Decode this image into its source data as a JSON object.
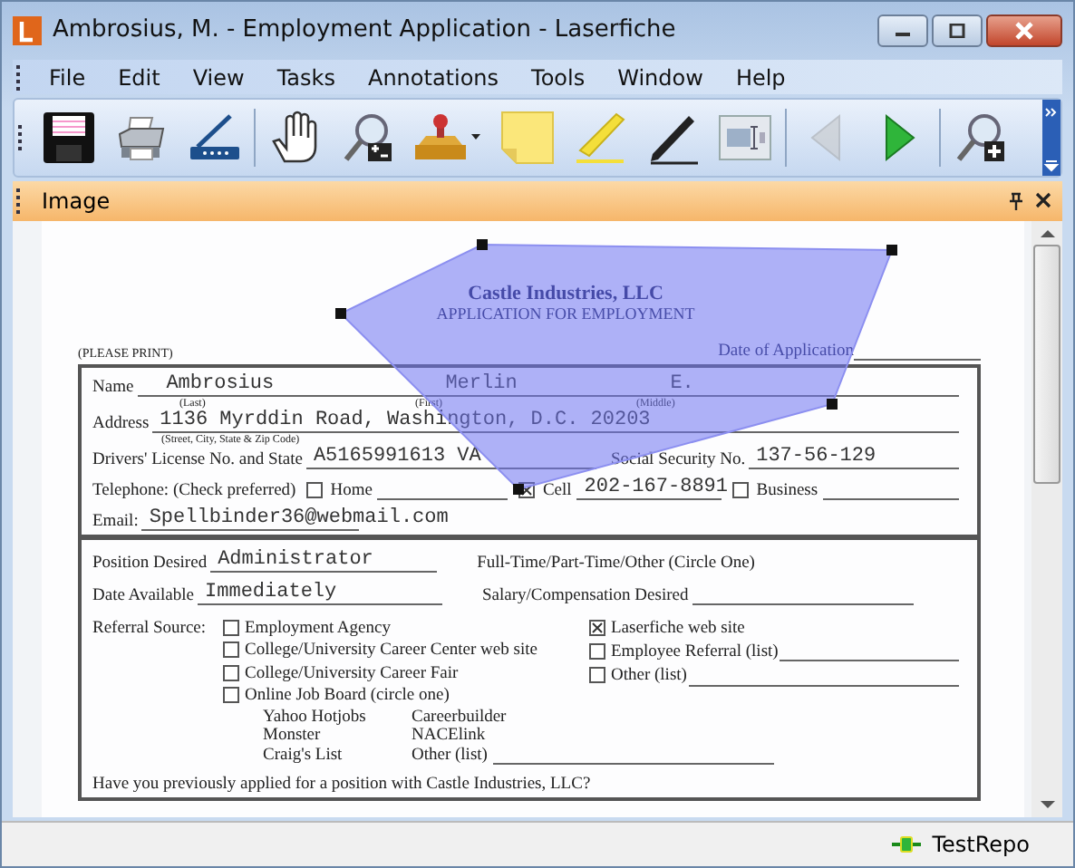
{
  "window": {
    "title": "Ambrosius, M. - Employment Application - Laserfiche"
  },
  "menu": [
    "File",
    "Edit",
    "View",
    "Tasks",
    "Annotations",
    "Tools",
    "Window",
    "Help"
  ],
  "toolbar": [
    [
      {
        "kind": "save",
        "disabled": false
      },
      {
        "kind": "print",
        "disabled": false
      },
      {
        "kind": "scan",
        "disabled": false
      }
    ],
    [
      {
        "kind": "hand",
        "disabled": false
      },
      {
        "kind": "zoom",
        "disabled": false
      },
      {
        "kind": "stamp",
        "disabled": false
      },
      {
        "kind": "sticky",
        "disabled": false
      },
      {
        "kind": "highlight",
        "disabled": false
      },
      {
        "kind": "pen",
        "disabled": false
      },
      {
        "kind": "textbox",
        "disabled": false
      }
    ],
    [
      {
        "kind": "prev",
        "disabled": true
      },
      {
        "kind": "next",
        "disabled": false
      }
    ],
    [
      {
        "kind": "zoomplus",
        "disabled": false
      }
    ]
  ],
  "pane": {
    "title": "Image"
  },
  "document": {
    "company": "Castle Industries, LLC",
    "form_title": "APPLICATION FOR EMPLOYMENT",
    "please_print": "(PLEASE PRINT)",
    "date_label": "Date of Application",
    "name": {
      "label": "Name",
      "values": [
        "Ambrosius",
        "Merlin",
        "E."
      ],
      "hints": [
        "(Last)",
        "(First)",
        "(Middle)"
      ]
    },
    "address": {
      "label": "Address",
      "value": "1136 Myrddin Road, Washington, D.C. 20203",
      "hint": "(Street, City, State & Zip Code)"
    },
    "license": {
      "label": "Drivers' License No. and State",
      "value": "A5165991613 VA"
    },
    "ssn": {
      "label": "Social Security No.",
      "value": "137-56-129"
    },
    "telephone": {
      "label": "Telephone: (Check preferred)",
      "options": [
        {
          "label": "Home",
          "checked": false
        },
        {
          "label": "Cell",
          "checked": true,
          "value": "202-167-8891"
        },
        {
          "label": "Business",
          "checked": false
        }
      ]
    },
    "email": {
      "label": "Email:",
      "value": "Spellbinder36@webmail.com"
    },
    "position": {
      "label": "Position Desired",
      "value": "Administrator"
    },
    "employment_type": "Full-Time/Part-Time/Other (Circle One)",
    "date_available": {
      "label": "Date Available",
      "value": "Immediately"
    },
    "salary_label": "Salary/Compensation Desired",
    "referral": {
      "label": "Referral Source:",
      "left": [
        {
          "label": "Employment Agency",
          "checked": false
        },
        {
          "label": "College/University Career Center web site",
          "checked": false
        },
        {
          "label": "College/University Career Fair",
          "checked": false
        },
        {
          "label": "Online Job Board (circle one)",
          "checked": false
        }
      ],
      "right": [
        {
          "label": "Laserfiche web site",
          "checked": true,
          "kind": "plain"
        },
        {
          "label": "Employee Referral (list)",
          "checked": false,
          "kind": "line"
        },
        {
          "label": "Other (list)",
          "checked": false,
          "kind": "line"
        }
      ],
      "job_boards": [
        [
          "Yahoo Hotjobs",
          "Careerbuilder"
        ],
        [
          "Monster",
          "NACElink"
        ],
        [
          "Craig's List",
          "Other (list)"
        ]
      ]
    },
    "question": "Have you previously applied for a position with Castle Industries, LLC?"
  },
  "status_bar": {
    "repository": "TestRepo"
  }
}
